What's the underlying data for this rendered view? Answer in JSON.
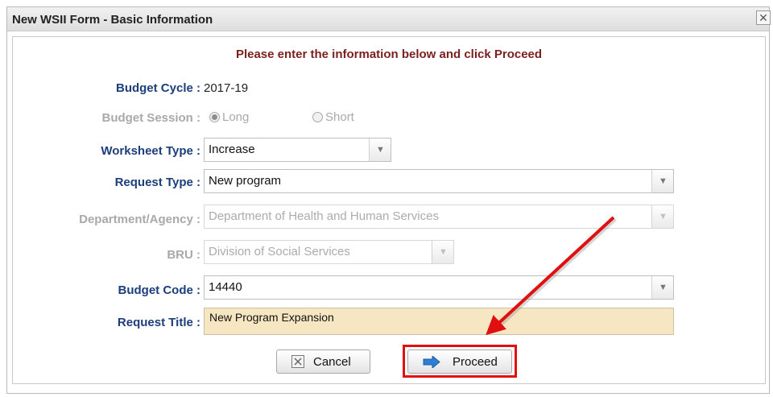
{
  "dialog": {
    "title": "New WSII Form - Basic Information",
    "close_glyph": "✕"
  },
  "instruction": "Please enter the information below and click Proceed",
  "fields": {
    "budget_cycle": {
      "label": "Budget Cycle :",
      "value": "2017-19"
    },
    "budget_session": {
      "label": "Budget Session :",
      "options": [
        "Long",
        "Short"
      ],
      "selected": "Long"
    },
    "worksheet_type": {
      "label": "Worksheet Type :",
      "value": "Increase"
    },
    "request_type": {
      "label": "Request Type :",
      "value": "New program"
    },
    "department": {
      "label": "Department/Agency :",
      "value": "Department of Health and Human Services"
    },
    "bru": {
      "label": "BRU :",
      "value": "Division of Social Services"
    },
    "budget_code": {
      "label": "Budget Code :",
      "value": "14440"
    },
    "request_title": {
      "label": "Request Title :",
      "value": "New Program Expansion"
    }
  },
  "buttons": {
    "cancel": "Cancel",
    "proceed": "Proceed"
  },
  "icons": {
    "dropdown": "chevron-down-icon",
    "cancel": "close-box-icon",
    "proceed": "arrow-right-icon"
  },
  "colors": {
    "label": "#1c3e7a",
    "instruction": "#7a1f1f",
    "highlight": "#e10f0f",
    "textbox": "#f6e6c2",
    "proceed_arrow": "#2e7fd1"
  }
}
